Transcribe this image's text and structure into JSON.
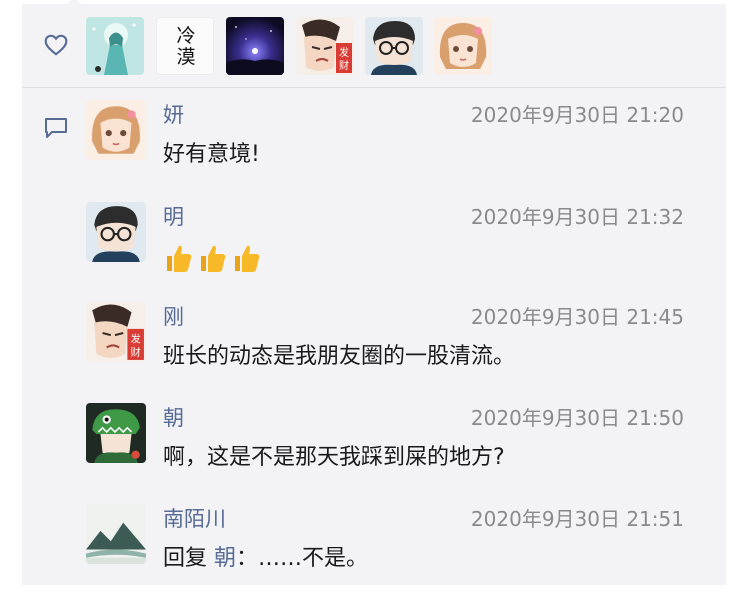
{
  "likes": {
    "icon": "heart-icon",
    "avatars": [
      {
        "name": "avatar-anime-girl-teal",
        "colors": [
          "#5fc2c0",
          "#d7f0ee"
        ]
      },
      {
        "name": "avatar-calligraphy",
        "text": "冷漠"
      },
      {
        "name": "avatar-night-sky",
        "colors": [
          "#1b1a4a",
          "#6f64c7"
        ]
      },
      {
        "name": "avatar-man-facai",
        "text": "发财"
      },
      {
        "name": "avatar-boy-glasses",
        "colors": [
          "#8ab0c8",
          "#e9e4dc"
        ]
      },
      {
        "name": "avatar-girl-pastel",
        "colors": [
          "#f2c9b0",
          "#fbe9de"
        ]
      }
    ]
  },
  "comments_icon": "comment-icon",
  "comments": [
    {
      "name": "妍",
      "time": "2020年9月30日 21:20",
      "text": "好有意境!",
      "avatar": "girl"
    },
    {
      "name": "明",
      "time": "2020年9月30日 21:32",
      "text": "",
      "emoji": [
        "👍",
        "👍",
        "👍"
      ],
      "avatar": "boy"
    },
    {
      "name": "刚",
      "time": "2020年9月30日 21:45",
      "text": "班长的动态是我朋友圈的一股清流。",
      "avatar": "facai"
    },
    {
      "name": "朝",
      "time": "2020年9月30日 21:50",
      "text": "啊，这是不是那天我踩到屎的地方?",
      "avatar": "dino"
    },
    {
      "name": "南陌川",
      "time": "2020年9月30日 21:51",
      "reply_prefix": "回复 ",
      "reply_to": "朝",
      "reply_text": "：……不是。",
      "avatar": "mountain"
    }
  ],
  "colors": {
    "link": "#576b95",
    "panel": "#f3f3f5",
    "text": "#1a1a1a",
    "time": "#8a8a8a"
  }
}
